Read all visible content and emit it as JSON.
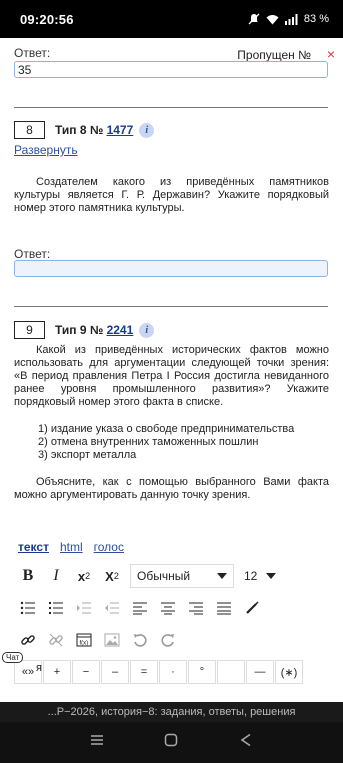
{
  "status_bar": {
    "time": "09:20:56",
    "battery": "83 %"
  },
  "prev_answer": {
    "label": "Ответ:",
    "value": "35",
    "skipped_label": "Пропущен №",
    "skip_close": "×"
  },
  "task8": {
    "num": "8",
    "type_prefix": "Тип 8 № ",
    "id": "1477",
    "info": "i",
    "expand": "Развернуть",
    "text": "Создателем какого из приведённых памятников культуры является Г. Р. Державин? Укажите порядковый номер этого памятника культуры.",
    "answer_label": "Ответ:",
    "answer_value": ""
  },
  "task9": {
    "num": "9",
    "type_prefix": "Тип 9 № ",
    "id": "2241",
    "info": "i",
    "text": "Какой из приведённых исторических фактов можно использовать для аргументации следующей точки зрения: «В период правления Петра I Россия достигла невиданного ранее уровня промышленного развития»? Укажите порядковый номер этого факта в списке.",
    "facts": [
      "1) издание указа о свободе предпринимательства",
      "2) отмена внутренних таможенных пошлин",
      "3) экспорт металла"
    ],
    "explain": "Объясните, как с помощью выбранного Вами факта можно аргументировать данную точку зрения."
  },
  "editor": {
    "tabs": [
      "текст",
      "html",
      "голос"
    ],
    "bold": "B",
    "italic": "I",
    "sup_base": "x",
    "sup": "2",
    "sub_base": "X",
    "sub": "2",
    "font": "Обычный",
    "size": "12",
    "symbols": [
      "«»",
      "+",
      "−",
      "–",
      "=",
      "·",
      "°",
      "",
      "—",
      "(∗)"
    ]
  },
  "chat_tag": "Чат",
  "tail_char": "я",
  "url_text": "...Р−2026, история−8: задания, ответы, решения"
}
